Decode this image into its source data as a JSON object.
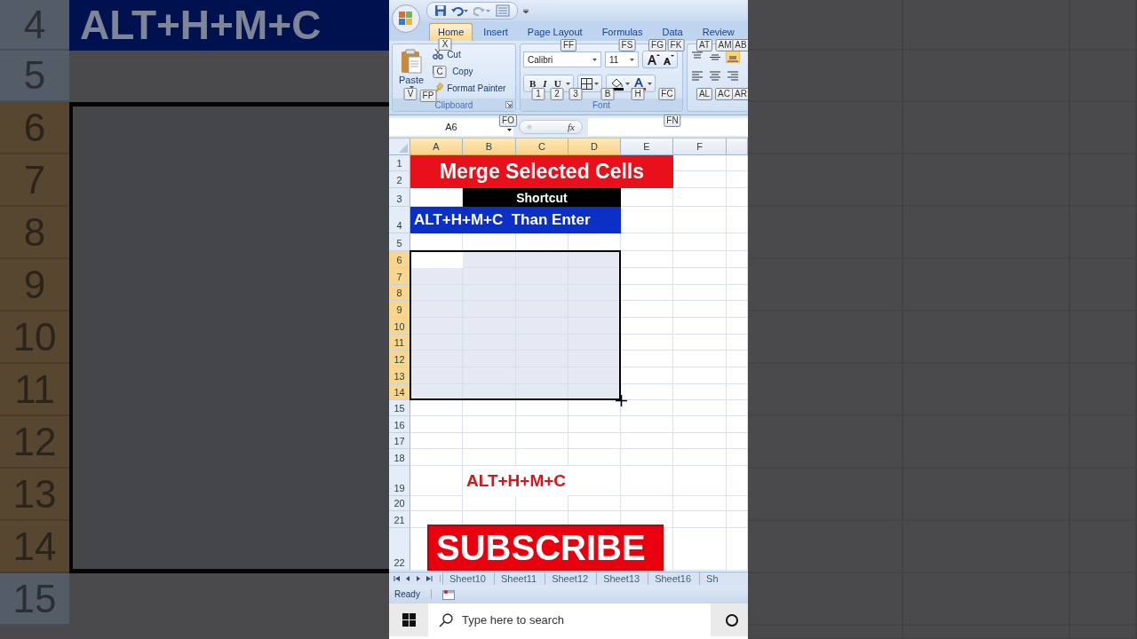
{
  "backdrop": {
    "banner": "ALT+H+M+C",
    "rows": [
      {
        "label": "4",
        "highlighted": false
      },
      {
        "label": "5",
        "highlighted": false
      },
      {
        "label": "6",
        "highlighted": true
      },
      {
        "label": "7",
        "highlighted": true
      },
      {
        "label": "8",
        "highlighted": true
      },
      {
        "label": "9",
        "highlighted": true
      },
      {
        "label": "10",
        "highlighted": true
      },
      {
        "label": "11",
        "highlighted": true
      },
      {
        "label": "12",
        "highlighted": true
      },
      {
        "label": "13",
        "highlighted": true
      },
      {
        "label": "14",
        "highlighted": true
      },
      {
        "label": "15",
        "highlighted": false
      }
    ]
  },
  "tabs": [
    {
      "label": "Home",
      "selected": true
    },
    {
      "label": "Insert",
      "selected": false
    },
    {
      "label": "Page Layout",
      "selected": false
    },
    {
      "label": "Formulas",
      "selected": false
    },
    {
      "label": "Data",
      "selected": false
    },
    {
      "label": "Review",
      "selected": false
    }
  ],
  "clipboard": {
    "label": "Clipboard",
    "paste": "Paste",
    "cut": "Cut",
    "copy": "Copy",
    "format_painter": "Format Painter"
  },
  "font_group": {
    "label": "Font",
    "font_name": "Calibri",
    "font_size": "11",
    "bold": "B",
    "italic": "I",
    "underline": "U"
  },
  "keytips": [
    "X",
    "C",
    "V",
    "FP",
    "FF",
    "FS",
    "FG",
    "FK",
    "AT",
    "AM",
    "AB",
    "1",
    "2",
    "3",
    "B",
    "H",
    "FC",
    "AL",
    "AC",
    "AR",
    "FO",
    "FN"
  ],
  "name_box": "A6",
  "function_label": "fx",
  "columns": [
    {
      "label": "A",
      "highlighted": true
    },
    {
      "label": "B",
      "highlighted": true
    },
    {
      "label": "C",
      "highlighted": true
    },
    {
      "label": "D",
      "highlighted": true
    },
    {
      "label": "E",
      "highlighted": false
    },
    {
      "label": "F",
      "highlighted": false
    }
  ],
  "rows": [
    {
      "label": "1",
      "highlighted": false
    },
    {
      "label": "2",
      "highlighted": false
    },
    {
      "label": "3",
      "highlighted": false
    },
    {
      "label": "4",
      "highlighted": false
    },
    {
      "label": "5",
      "highlighted": false
    },
    {
      "label": "6",
      "highlighted": true
    },
    {
      "label": "7",
      "highlighted": true
    },
    {
      "label": "8",
      "highlighted": true
    },
    {
      "label": "9",
      "highlighted": true
    },
    {
      "label": "10",
      "highlighted": true
    },
    {
      "label": "11",
      "highlighted": true
    },
    {
      "label": "12",
      "highlighted": true
    },
    {
      "label": "13",
      "highlighted": true
    },
    {
      "label": "14",
      "highlighted": true
    },
    {
      "label": "15",
      "highlighted": false
    },
    {
      "label": "16",
      "highlighted": false
    },
    {
      "label": "17",
      "highlighted": false
    },
    {
      "label": "18",
      "highlighted": false
    },
    {
      "label": "19",
      "highlighted": false
    },
    {
      "label": "20",
      "highlighted": false
    },
    {
      "label": "21",
      "highlighted": false
    },
    {
      "label": "22",
      "highlighted": false
    }
  ],
  "cells": [
    {
      "kind": "title",
      "text": "Merge Selected Cells"
    },
    {
      "kind": "header",
      "text": "Shortcut"
    },
    {
      "kind": "shortcut",
      "text": "ALT+H+M+C  Than Enter"
    },
    {
      "kind": "note",
      "text": "ALT+H+M+C"
    }
  ],
  "subscribe": "SUBSCRIBE",
  "sheet_tabs": [
    "Sheet10",
    "Sheet11",
    "Sheet12",
    "Sheet13",
    "Sheet16",
    "Sh"
  ],
  "status": "Ready",
  "taskbar": {
    "search_placeholder": "Type here to search"
  }
}
